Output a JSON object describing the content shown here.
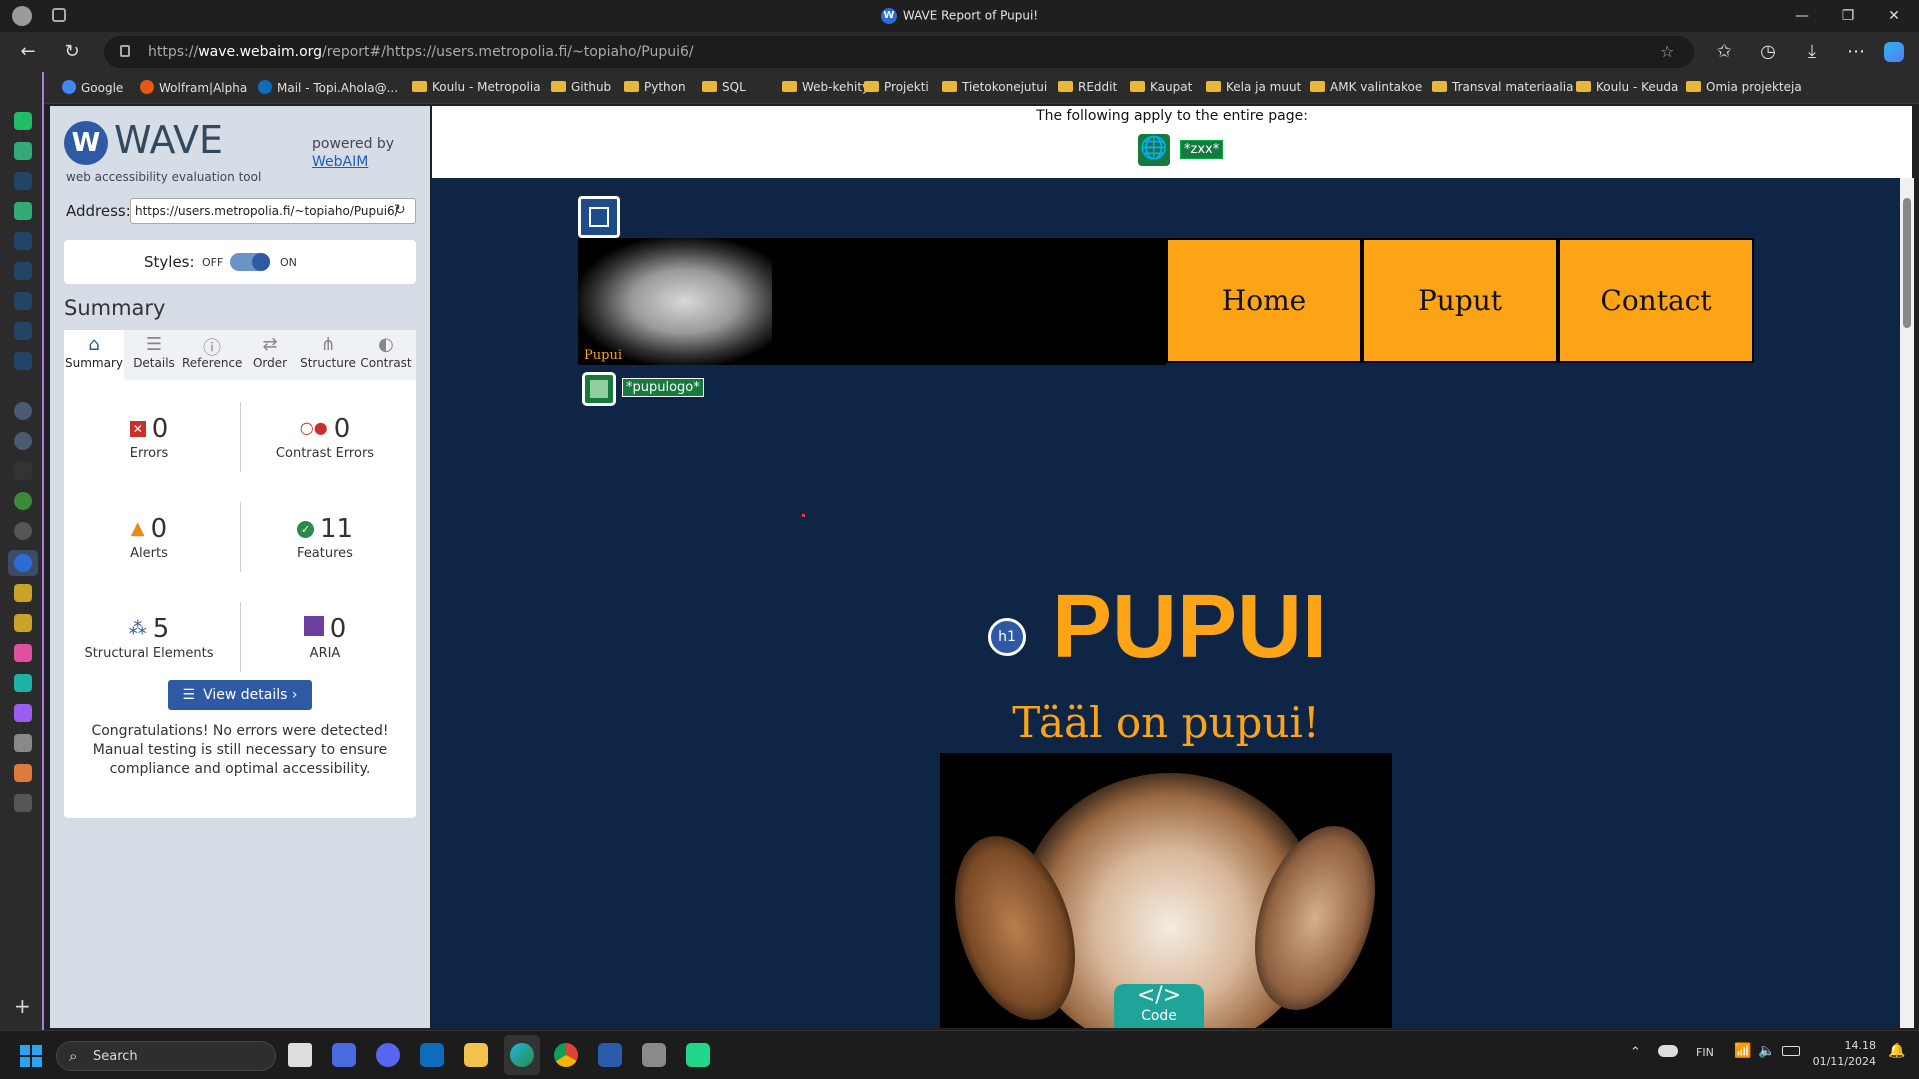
{
  "window": {
    "title": "WAVE Report of Pupui!",
    "url_domain": "wave.webaim.org",
    "url_prefix": "https://",
    "url_rest": "/report#/https://users.metropolia.fi/~topiaho/Pupui6/"
  },
  "bookmarks": [
    {
      "label": "Google",
      "type": "site",
      "color": "#4285f4"
    },
    {
      "label": "Wolfram|Alpha",
      "type": "site",
      "color": "#e45a12"
    },
    {
      "label": "Mail - Topi.Ahola@...",
      "type": "site",
      "color": "#0f6cbd"
    },
    {
      "label": "Koulu - Metropolia",
      "type": "folder"
    },
    {
      "label": "Github",
      "type": "folder"
    },
    {
      "label": "Python",
      "type": "folder"
    },
    {
      "label": "SQL",
      "type": "folder"
    },
    {
      "label": "Web-kehitys",
      "type": "folder"
    },
    {
      "label": "Projekti",
      "type": "folder"
    },
    {
      "label": "Tietokonejutui",
      "type": "folder"
    },
    {
      "label": "REddit",
      "type": "folder"
    },
    {
      "label": "Kaupat",
      "type": "folder"
    },
    {
      "label": "Kela ja muut",
      "type": "folder"
    },
    {
      "label": "AMK valintakoe",
      "type": "folder"
    },
    {
      "label": "Transval materiaalia",
      "type": "folder"
    },
    {
      "label": "Koulu - Keuda",
      "type": "folder"
    },
    {
      "label": "Omia projekteja",
      "type": "folder"
    }
  ],
  "wave": {
    "logo_text": "WAVE",
    "tagline": "web accessibility evaluation tool",
    "powered_by": "powered by",
    "webaim_link": "WebAIM",
    "address_label": "Address:",
    "address_value": "https://users.metropolia.fi/~topiaho/Pupui6/",
    "styles_label": "Styles:",
    "styles_off": "OFF",
    "styles_on": "ON",
    "summary_heading": "Summary",
    "tabs": [
      "Summary",
      "Details",
      "Reference",
      "Order",
      "Structure",
      "Contrast"
    ],
    "stats": {
      "errors": {
        "count": "0",
        "label": "Errors"
      },
      "contrast": {
        "count": "0",
        "label": "Contrast Errors"
      },
      "alerts": {
        "count": "0",
        "label": "Alerts"
      },
      "features": {
        "count": "11",
        "label": "Features"
      },
      "structural": {
        "count": "5",
        "label": "Structural Elements"
      },
      "aria": {
        "count": "0",
        "label": "ARIA"
      }
    },
    "view_details": "View details ›",
    "congrats": "Congratulations! No errors were detected! Manual testing is still necessary to ensure compliance and optimal accessibility."
  },
  "page": {
    "applies_text": "The following apply to the entire page:",
    "lang_badge": "*zxx*",
    "logo_caption": "Pupui",
    "logo_badge": "*pupulogo*",
    "nav": [
      "Home",
      "Puput",
      "Contact"
    ],
    "h1_icon": "h1",
    "heading": "PUPUI",
    "subheading": "Tääl on pupui!",
    "code_button": "Code"
  },
  "taskbar": {
    "search_placeholder": "Search",
    "lang": "FIN",
    "time": "14.18",
    "date": "01/11/2024"
  }
}
